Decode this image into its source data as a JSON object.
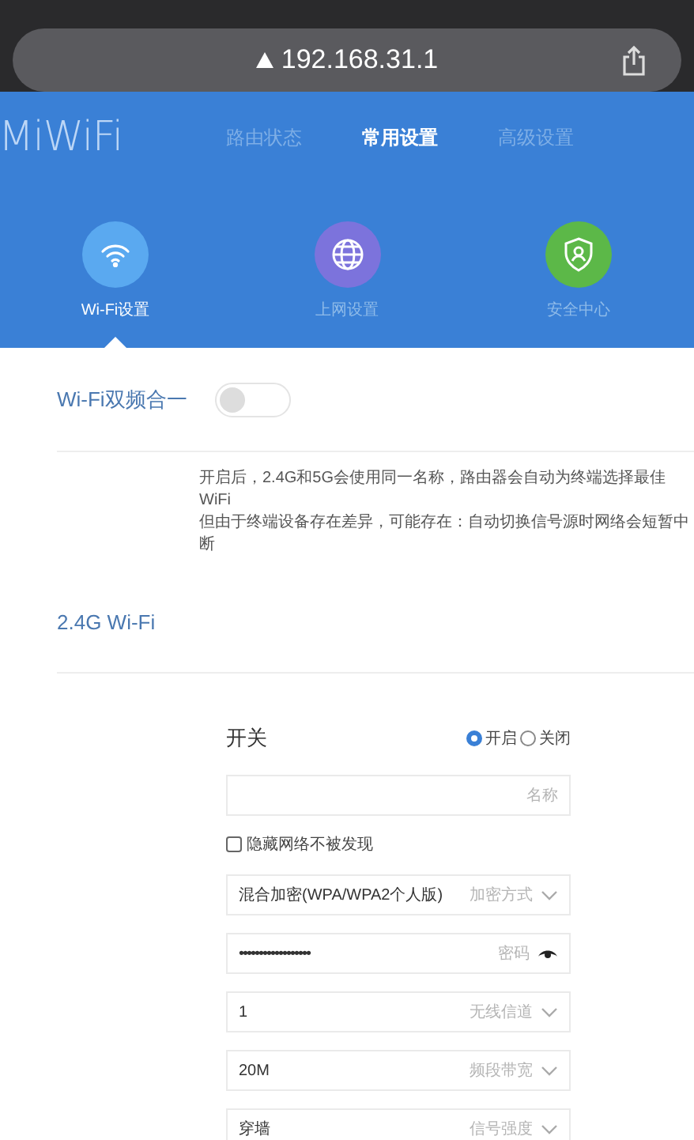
{
  "browser": {
    "url": "192.168.31.1"
  },
  "header": {
    "logo": "MiWiFi",
    "nav": [
      {
        "label": "路由状态",
        "selected": false
      },
      {
        "label": "常用设置",
        "selected": true
      },
      {
        "label": "高级设置",
        "selected": false
      }
    ],
    "tiles": [
      {
        "label": "Wi-Fi设置",
        "selected": true,
        "color": "#5aa9f0"
      },
      {
        "label": "上网设置",
        "selected": false,
        "color": "#7c73dc"
      },
      {
        "label": "安全中心",
        "selected": false,
        "color": "#5cb848"
      }
    ]
  },
  "dual_band": {
    "label": "Wi-Fi双频合一",
    "on": false,
    "description": [
      "开启后，2.4G和5G会使用同一名称，路由器会自动为终端选择最佳WiFi",
      "但由于终端设备存在差异，可能存在：自动切换信号源时网络会短暂中断"
    ]
  },
  "section": {
    "title": "2.4G Wi-Fi"
  },
  "form": {
    "switch_label": "开关",
    "options": [
      {
        "label": "开启",
        "selected": true
      },
      {
        "label": "关闭",
        "selected": false
      }
    ],
    "fields": [
      {
        "kind": "text",
        "label": "名称"
      },
      {
        "kind": "checkbox",
        "label": "隐藏网络不被发现",
        "checked": false
      },
      {
        "kind": "select",
        "value": "混合加密(WPA/WPA2个人版)",
        "label": "加密方式"
      },
      {
        "kind": "password",
        "value": "••••••••••••••••••",
        "label": "密码"
      },
      {
        "kind": "select",
        "value": "1",
        "label": "无线信道"
      },
      {
        "kind": "select",
        "value": "20M",
        "label": "频段带宽"
      },
      {
        "kind": "select",
        "value": "穿墙",
        "label": "信号强度"
      }
    ]
  }
}
